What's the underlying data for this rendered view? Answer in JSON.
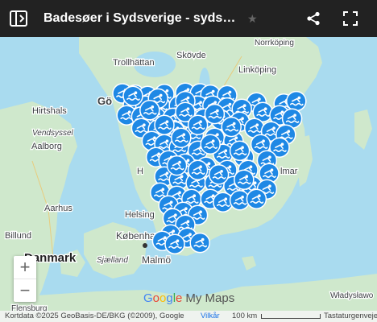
{
  "header": {
    "title": "Badesøer i Sydsverige - sydsverigeferie.dk",
    "colors": {
      "bar": "#222222",
      "text": "#ffffff"
    }
  },
  "map": {
    "colors": {
      "water": "#a9dbef",
      "land": "#cfe8cc",
      "marker": "#1e88e5"
    },
    "place_labels": [
      {
        "name": "Trollhättan",
        "kind": "city"
      },
      {
        "name": "Skövde",
        "kind": "city"
      },
      {
        "name": "Norrköping",
        "kind": "city"
      },
      {
        "name": "Linköping",
        "kind": "city"
      },
      {
        "name": "Gö",
        "kind": "city"
      },
      {
        "name": "Hirtshals",
        "kind": "city"
      },
      {
        "name": "Vendsyssel",
        "kind": "region"
      },
      {
        "name": "Aalborg",
        "kind": "city"
      },
      {
        "name": "Aarhus",
        "kind": "city"
      },
      {
        "name": "Billund",
        "kind": "city"
      },
      {
        "name": "Danmark",
        "kind": "country"
      },
      {
        "name": "Helsing",
        "kind": "city"
      },
      {
        "name": "København",
        "kind": "city"
      },
      {
        "name": "Sjælland",
        "kind": "region"
      },
      {
        "name": "Malmö",
        "kind": "city"
      },
      {
        "name": "Flensburg",
        "kind": "city"
      },
      {
        "name": "Władysławo",
        "kind": "city"
      },
      {
        "name": "H",
        "kind": "city"
      },
      {
        "name": "lmar",
        "kind": "city"
      }
    ],
    "markers": [
      {
        "lat": 57.74,
        "lng": 12.1
      },
      {
        "lat": 57.72,
        "lng": 12.4
      },
      {
        "lat": 57.7,
        "lng": 12.7
      },
      {
        "lat": 57.73,
        "lng": 13.1
      },
      {
        "lat": 57.75,
        "lng": 13.6
      },
      {
        "lat": 57.74,
        "lng": 13.95
      },
      {
        "lat": 57.72,
        "lng": 14.2
      },
      {
        "lat": 57.71,
        "lng": 14.6
      },
      {
        "lat": 57.6,
        "lng": 15.3
      },
      {
        "lat": 57.58,
        "lng": 15.95
      },
      {
        "lat": 57.62,
        "lng": 16.25
      },
      {
        "lat": 57.55,
        "lng": 12.35
      },
      {
        "lat": 57.55,
        "lng": 12.65
      },
      {
        "lat": 57.55,
        "lng": 13.0
      },
      {
        "lat": 57.55,
        "lng": 13.45
      },
      {
        "lat": 57.55,
        "lng": 13.9
      },
      {
        "lat": 57.55,
        "lng": 14.25
      },
      {
        "lat": 57.52,
        "lng": 14.6
      },
      {
        "lat": 57.5,
        "lng": 14.95
      },
      {
        "lat": 57.45,
        "lng": 15.45
      },
      {
        "lat": 57.4,
        "lng": 15.85
      },
      {
        "lat": 57.35,
        "lng": 16.15
      },
      {
        "lat": 57.4,
        "lng": 12.2
      },
      {
        "lat": 57.38,
        "lng": 12.55
      },
      {
        "lat": 57.37,
        "lng": 12.9
      },
      {
        "lat": 57.36,
        "lng": 13.3
      },
      {
        "lat": 57.36,
        "lng": 13.7
      },
      {
        "lat": 57.35,
        "lng": 14.05
      },
      {
        "lat": 57.33,
        "lng": 14.45
      },
      {
        "lat": 57.3,
        "lng": 14.9
      },
      {
        "lat": 57.2,
        "lng": 15.25
      },
      {
        "lat": 57.15,
        "lng": 15.65
      },
      {
        "lat": 57.1,
        "lng": 16.0
      },
      {
        "lat": 57.2,
        "lng": 12.55
      },
      {
        "lat": 57.18,
        "lng": 12.95
      },
      {
        "lat": 57.15,
        "lng": 13.35
      },
      {
        "lat": 57.1,
        "lng": 13.8
      },
      {
        "lat": 57.05,
        "lng": 14.3
      },
      {
        "lat": 57.0,
        "lng": 14.75
      },
      {
        "lat": 56.95,
        "lng": 15.4
      },
      {
        "lat": 56.9,
        "lng": 15.85
      },
      {
        "lat": 57.0,
        "lng": 12.8
      },
      {
        "lat": 56.95,
        "lng": 13.1
      },
      {
        "lat": 56.9,
        "lng": 13.45
      },
      {
        "lat": 56.85,
        "lng": 13.9
      },
      {
        "lat": 56.8,
        "lng": 14.5
      },
      {
        "lat": 56.75,
        "lng": 15.0
      },
      {
        "lat": 56.7,
        "lng": 15.55
      },
      {
        "lat": 56.75,
        "lng": 12.9
      },
      {
        "lat": 56.7,
        "lng": 13.2
      },
      {
        "lat": 56.65,
        "lng": 13.6
      },
      {
        "lat": 56.6,
        "lng": 14.1
      },
      {
        "lat": 56.55,
        "lng": 14.6
      },
      {
        "lat": 56.55,
        "lng": 15.1
      },
      {
        "lat": 56.5,
        "lng": 15.6
      },
      {
        "lat": 56.45,
        "lng": 13.1
      },
      {
        "lat": 56.4,
        "lng": 13.45
      },
      {
        "lat": 56.35,
        "lng": 13.85
      },
      {
        "lat": 56.35,
        "lng": 14.3
      },
      {
        "lat": 56.3,
        "lng": 14.75
      },
      {
        "lat": 56.3,
        "lng": 15.2
      },
      {
        "lat": 56.25,
        "lng": 15.55
      },
      {
        "lat": 56.2,
        "lng": 13.0
      },
      {
        "lat": 56.15,
        "lng": 13.4
      },
      {
        "lat": 56.1,
        "lng": 13.75
      },
      {
        "lat": 56.1,
        "lng": 14.2
      },
      {
        "lat": 56.05,
        "lng": 14.5
      },
      {
        "lat": 56.08,
        "lng": 14.9
      },
      {
        "lat": 56.1,
        "lng": 15.3
      },
      {
        "lat": 56.0,
        "lng": 13.2
      },
      {
        "lat": 55.9,
        "lng": 13.55
      },
      {
        "lat": 55.85,
        "lng": 13.9
      },
      {
        "lat": 55.8,
        "lng": 13.3
      },
      {
        "lat": 55.7,
        "lng": 13.6
      },
      {
        "lat": 55.55,
        "lng": 13.25
      },
      {
        "lat": 55.5,
        "lng": 13.65
      },
      {
        "lat": 55.45,
        "lng": 13.05
      },
      {
        "lat": 55.4,
        "lng": 13.35
      },
      {
        "lat": 55.42,
        "lng": 13.95
      },
      {
        "lat": 57.7,
        "lng": 12.35
      },
      {
        "lat": 57.66,
        "lng": 12.95
      },
      {
        "lat": 57.62,
        "lng": 13.6
      },
      {
        "lat": 57.48,
        "lng": 12.75
      },
      {
        "lat": 57.45,
        "lng": 13.6
      },
      {
        "lat": 57.42,
        "lng": 14.3
      },
      {
        "lat": 57.25,
        "lng": 13.1
      },
      {
        "lat": 57.25,
        "lng": 13.9
      },
      {
        "lat": 57.22,
        "lng": 14.7
      },
      {
        "lat": 57.05,
        "lng": 13.5
      },
      {
        "lat": 56.95,
        "lng": 14.2
      },
      {
        "lat": 56.85,
        "lng": 14.9
      },
      {
        "lat": 56.62,
        "lng": 13.4
      },
      {
        "lat": 56.55,
        "lng": 13.9
      },
      {
        "lat": 56.48,
        "lng": 14.4
      },
      {
        "lat": 56.4,
        "lng": 15.0
      }
    ]
  },
  "controls": {
    "zoom_in": "+",
    "zoom_out": "−"
  },
  "branding": {
    "google": [
      "G",
      "o",
      "o",
      "g",
      "l",
      "e"
    ],
    "google_colors": [
      "#4285f4",
      "#ea4335",
      "#fbbc05",
      "#4285f4",
      "#34a853",
      "#ea4335"
    ],
    "product": "My Maps"
  },
  "footer": {
    "attribution": "Kortdata ©2025 GeoBasis-DE/BKG (©2009), Google",
    "terms": "Vilkår",
    "scale": "100 km",
    "shortcuts": "Tastaturgenveje"
  }
}
